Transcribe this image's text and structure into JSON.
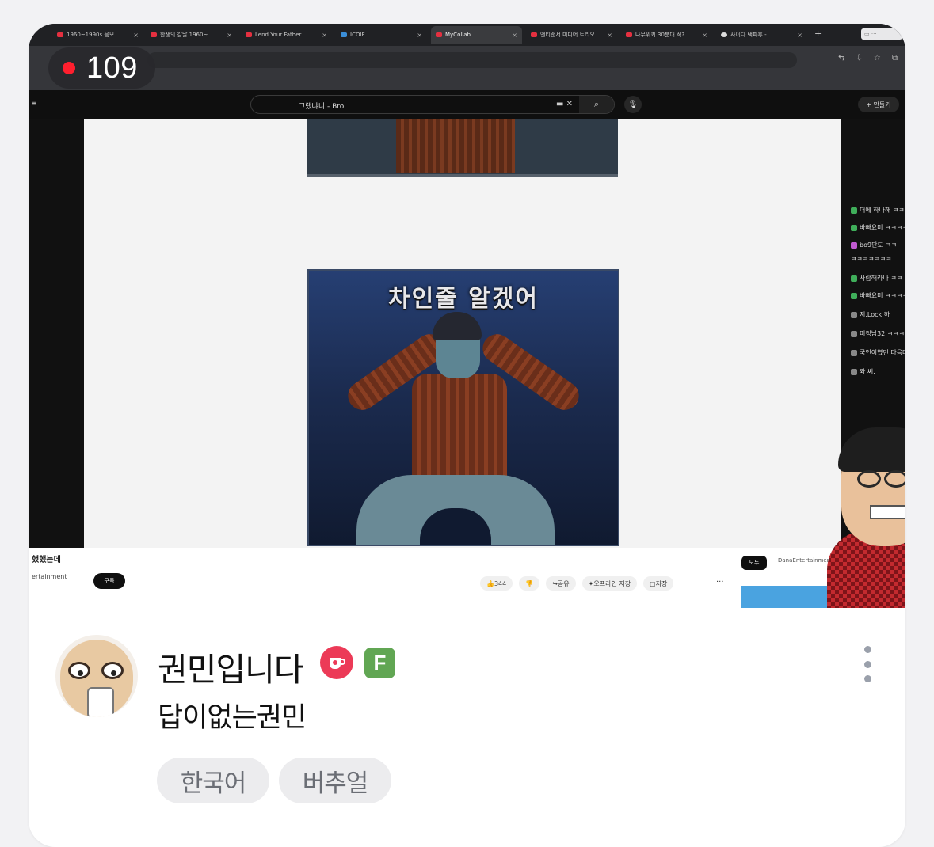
{
  "stream": {
    "viewer_count": "109",
    "live_indicator_color": "#ff1f2e"
  },
  "thumbnail": {
    "browser_tabs": [
      "1960~1990s 음모",
      "한쟁의 칼날 1960~",
      "Lend Your Father",
      "ICOIF",
      "MyCollab",
      "앤티랜서 미디어 트리오",
      "나무위키 30분대 적?",
      "사이다 택파후 -"
    ],
    "search_query": "그랬냐니 - Bro",
    "create_label": "+ 만들기",
    "panel_caption": "차인줄 알겠어",
    "video_title_fragment": "했했는데",
    "channel_fragment": "ertainment",
    "subscribe_label": "구독",
    "action_labels": [
      "344",
      "공유",
      "오프라인 저장",
      "저장"
    ],
    "chat_chip_selected": "모두",
    "chat_chip_other": "DanaEntertainment",
    "chat_lines": [
      "더에 하나해 ㅋㅋ",
      "바빠요미 ㅋㅋㅋㅋ",
      "bo9단도 ㅋㅋ",
      "ㅋㅋㅋㅋㅋㅋㅋ",
      "사람해라나 ㅋㅋ",
      "바빠요미 ㅋㅋㅋㅋ",
      "지.Lock 하",
      "미정남32 ㅋㅋㅋㅋ",
      "국인이였던 다음다",
      "와 씨."
    ]
  },
  "channel": {
    "name": "권민입니다",
    "badge_f": "F",
    "stream_title": "답이없는권민",
    "badge_cup_color": "#ec3a57",
    "badge_f_color": "#61a653"
  },
  "tags": [
    "한국어",
    "버추얼"
  ],
  "icons": {
    "more": "more-vertical-icon",
    "cup": "coffee-cup-icon"
  }
}
